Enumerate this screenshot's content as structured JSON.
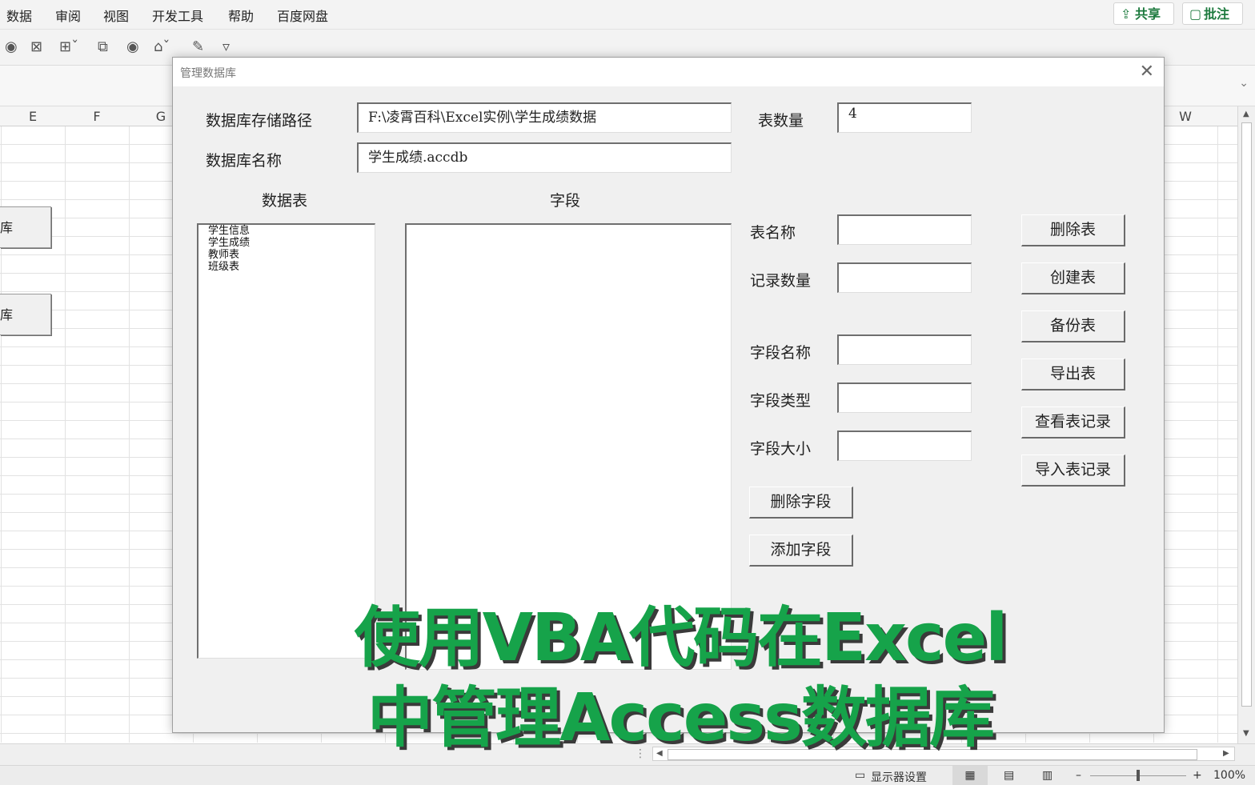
{
  "menu": [
    "数据",
    "审阅",
    "视图",
    "开发工具",
    "帮助",
    "百度网盘"
  ],
  "ribbon_actions": {
    "share": "共享",
    "comment": "批注"
  },
  "columns": {
    "e": "E",
    "f": "F",
    "g": "G",
    "w": "W"
  },
  "sheet_buttons": [
    "库",
    "库"
  ],
  "dialog": {
    "title": "管理数据库",
    "db_path_label": "数据库存储路径",
    "db_path": "F:\\凌霄百科\\Excel实例\\学生成绩数据",
    "table_count_label": "表数量",
    "table_count": "4",
    "db_name_label": "数据库名称",
    "db_name": "学生成绩.accdb",
    "tables_header": "数据表",
    "fields_header": "字段",
    "tables": [
      "学生信息",
      "学生成绩",
      "教师表",
      "班级表"
    ],
    "fields": [],
    "table_name_label": "表名称",
    "record_count_label": "记录数量",
    "field_name_label": "字段名称",
    "field_type_label": "字段类型",
    "field_size_label": "字段大小",
    "buttons": {
      "delete_table": "删除表",
      "create_table": "创建表",
      "backup_table": "备份表",
      "export_table": "导出表",
      "view_records": "查看表记录",
      "import_records": "导入表记录",
      "delete_field": "删除字段",
      "add_field": "添加字段"
    }
  },
  "overlay": {
    "line1": "使用VBA代码在Excel",
    "line2": "中管理Access数据库"
  },
  "status": {
    "display_settings": "显示器设置",
    "zoom": "100%"
  },
  "colors": {
    "overlay": "#16a34a",
    "accent": "#1d7a3e"
  }
}
